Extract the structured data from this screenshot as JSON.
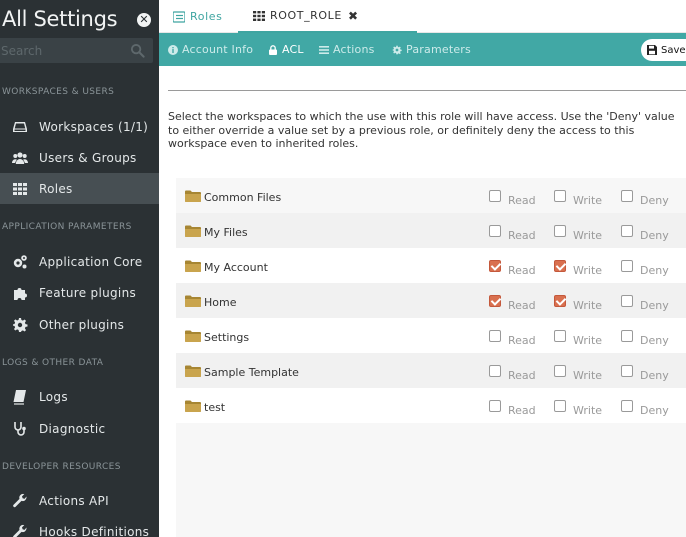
{
  "sidebar": {
    "title": "All Settings",
    "search_placeholder": "Search",
    "sections": [
      {
        "label": "WORKSPACES & USERS"
      },
      {
        "label": "APPLICATION PARAMETERS"
      },
      {
        "label": "LOGS & OTHER DATA"
      },
      {
        "label": "DEVELOPER RESOURCES"
      }
    ],
    "items": [
      {
        "label": "Workspaces (1/1)",
        "icon": "drive-icon"
      },
      {
        "label": "Users & Groups",
        "icon": "users-icon"
      },
      {
        "label": "Roles",
        "icon": "grid-icon",
        "active": true
      },
      {
        "label": "Application Core",
        "icon": "cogs-icon"
      },
      {
        "label": "Feature plugins",
        "icon": "puzzle-icon"
      },
      {
        "label": "Other plugins",
        "icon": "gear-icon"
      },
      {
        "label": "Logs",
        "icon": "book-icon"
      },
      {
        "label": "Diagnostic",
        "icon": "stethoscope-icon"
      },
      {
        "label": "Actions API",
        "icon": "wrench-icon"
      },
      {
        "label": "Hooks Definitions",
        "icon": "wrench-icon"
      }
    ]
  },
  "tabs": {
    "roles": "Roles",
    "root_role": "ROOT_ROLE"
  },
  "subtabs": {
    "account_info": "Account Info",
    "acl": "ACL",
    "actions": "Actions",
    "parameters": "Parameters",
    "save": "Save"
  },
  "description": "Select the workspaces to which the use with this role will have access. Use the 'Deny' value to either override a value set by a previous role, or definitely deny the access to this workspace even to inherited roles.",
  "perm_labels": {
    "read": "Read",
    "write": "Write",
    "deny": "Deny"
  },
  "workspaces": [
    {
      "name": "Common Files",
      "read": false,
      "write": false,
      "deny": false
    },
    {
      "name": "My Files",
      "read": false,
      "write": false,
      "deny": false
    },
    {
      "name": "My Account",
      "read": true,
      "write": true,
      "deny": false
    },
    {
      "name": "Home",
      "read": true,
      "write": true,
      "deny": false
    },
    {
      "name": "Settings",
      "read": false,
      "write": false,
      "deny": false
    },
    {
      "name": "Sample Template",
      "read": false,
      "write": false,
      "deny": false
    },
    {
      "name": "test",
      "read": false,
      "write": false,
      "deny": false
    }
  ],
  "colors": {
    "accent": "#41a8a5",
    "sidebar_bg": "#2b3134",
    "checked": "#d9704f"
  }
}
